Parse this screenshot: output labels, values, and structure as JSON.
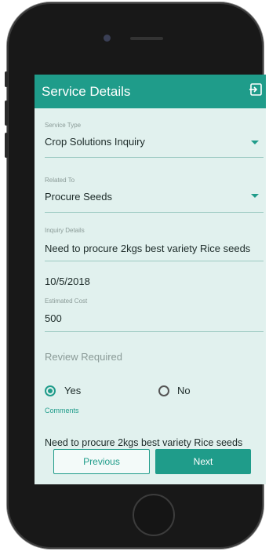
{
  "app_bar": {
    "title": "Service Details",
    "exit_icon": "exit-to-app-icon"
  },
  "form": {
    "service_type": {
      "label": "Service Type",
      "value": "Crop Solutions Inquiry"
    },
    "related_to": {
      "label": "Related To",
      "value": "Procure Seeds"
    },
    "inquiry_details": {
      "label": "Inquiry Details",
      "value": "Need to procure 2kgs best variety Rice seeds"
    },
    "date": {
      "value": "10/5/2018"
    },
    "estimated_cost": {
      "label": "Estimated Cost",
      "value": "500"
    },
    "review_required": {
      "label": "Review Required",
      "yes": "Yes",
      "no": "No",
      "selected": "Yes"
    },
    "comments": {
      "label": "Comments",
      "value": "Need to procure 2kgs best variety Rice seeds"
    }
  },
  "buttons": {
    "previous": "Previous",
    "next": "Next"
  },
  "colors": {
    "accent": "#1f9c8a",
    "screen_bg": "#e1f1ee",
    "phone_frame": "#181818"
  }
}
